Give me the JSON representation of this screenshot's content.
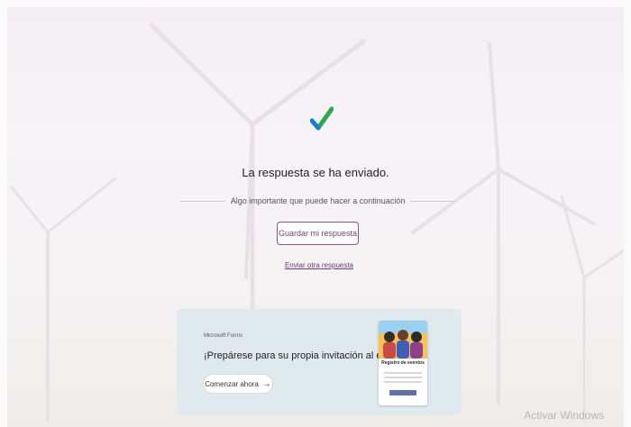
{
  "confirmation": {
    "title": "La respuesta se ha enviado.",
    "divider_text": "Algo importante que puede hacer a continuación",
    "save_button_label": "Guardar mi respuesta",
    "another_response_link": "Enviar otra respuesta"
  },
  "promo": {
    "brand": "Microsoft Forms",
    "heading": "¡Prepárese para su propia invitación al evento!",
    "cta_label": "Comenzar ahora",
    "cta_icon": "arrow-right-icon",
    "flyer_title": "Registro de eventos"
  },
  "system": {
    "watermark": "Activar Windows"
  },
  "colors": {
    "accent": "#8f5189",
    "check_green": "#2fa84f",
    "check_blue": "#1a7fd1",
    "card_bg": "#dfe9ee"
  }
}
